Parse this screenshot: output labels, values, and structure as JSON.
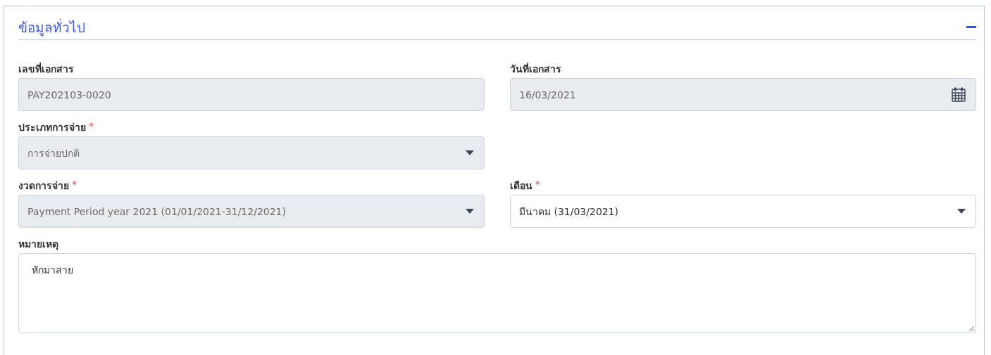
{
  "panel": {
    "title": "ข้อมูลทั่วไป",
    "expanded": true
  },
  "rows": [
    {
      "fields": [
        {
          "kind": "text",
          "label": "เลขที่เอกสาร",
          "disabled": true,
          "value": "PAY202103-0020"
        },
        {
          "kind": "date",
          "label": "วันที่เอกสาร",
          "disabled": true,
          "value": "16/03/2021"
        }
      ]
    },
    {
      "fields": [
        {
          "kind": "select",
          "label": "ประเภทการจ่าย",
          "required_mark": "*",
          "disabled": true,
          "value": "การจ่ายปกติ"
        }
      ]
    },
    {
      "fields": [
        {
          "kind": "select",
          "label": "งวดการจ่าย",
          "required_mark": "*",
          "disabled": true,
          "value": "Payment Period year 2021 (01/01/2021-31/12/2021)"
        },
        {
          "kind": "select",
          "label": "เดือน",
          "required_mark": "*",
          "disabled": false,
          "value": "มีนาคม (31/03/2021)"
        }
      ]
    },
    {
      "fields": [
        {
          "kind": "textarea",
          "label": "หมายเหตุ",
          "disabled": false,
          "value": "หักมาสาย"
        }
      ]
    }
  ]
}
